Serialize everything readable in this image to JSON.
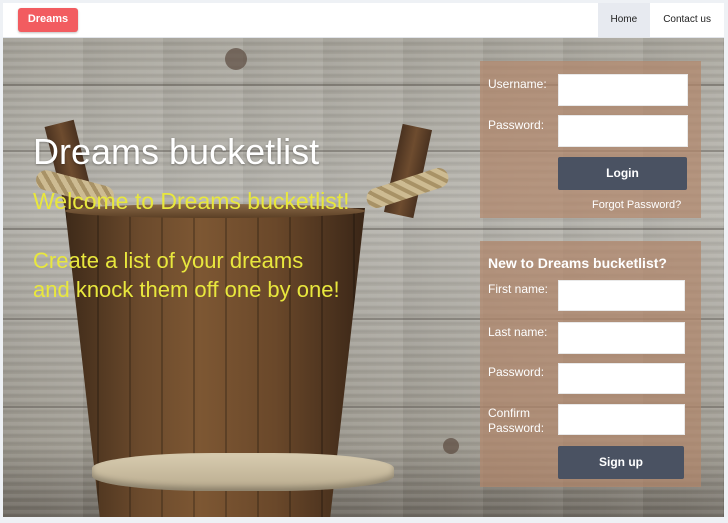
{
  "navbar": {
    "brand": "Dreams",
    "links": [
      "Home",
      "Contact us"
    ],
    "active": "Home"
  },
  "hero": {
    "title": "Dreams bucketlist",
    "subtitle": "Welcome to Dreams bucketlist!",
    "tagline_line1": "Create a list of your dreams",
    "tagline_line2": "and knock them off one by one!"
  },
  "login": {
    "username_label": "Username:",
    "password_label": "Password:",
    "username_value": "",
    "password_value": "",
    "login_button": "Login",
    "forgot_link": "Forgot Password?"
  },
  "signup": {
    "title": "New to Dreams bucketlist?",
    "first_name_label": "First name:",
    "last_name_label": "Last name:",
    "password_label": "Password:",
    "confirm_label_line1": "Confirm",
    "confirm_label_line2": "Password:",
    "signup_button": "Sign up"
  },
  "colors": {
    "brand": "#f25c60",
    "button": "#4a5262",
    "tagline": "#e8e73d",
    "panel": "#b2866b"
  }
}
